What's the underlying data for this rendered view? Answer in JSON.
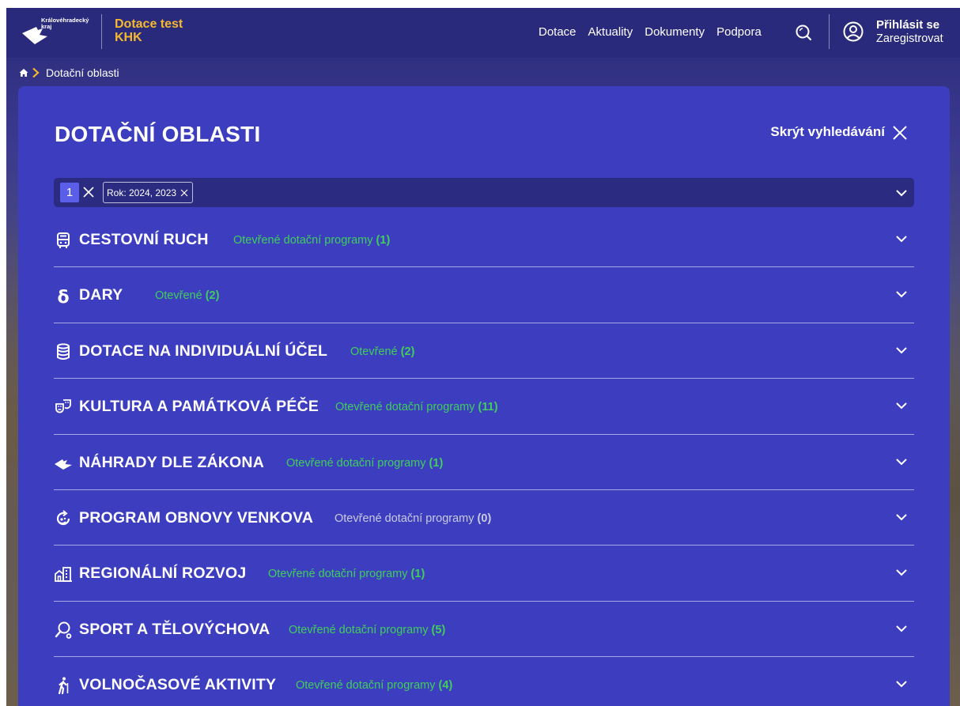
{
  "header": {
    "logo_text_line1": "Královéhradecký",
    "logo_text_line2": "kraj",
    "site_title_line1": "Dotace test",
    "site_title_line2": "KHK",
    "nav": [
      {
        "label": "Dotace"
      },
      {
        "label": "Aktuality"
      },
      {
        "label": "Dokumenty"
      },
      {
        "label": "Podpora"
      }
    ],
    "login_label": "Přihlásit se",
    "register_label": "Zaregistrovat"
  },
  "breadcrumb": {
    "current": "Dotační oblasti"
  },
  "main": {
    "title": "DOTAČNÍ OBLASTI",
    "hide_search_label": "Skrýt vyhledávání",
    "filter": {
      "count": "1",
      "chip_label": "Rok: 2024, 2023"
    },
    "categories": [
      {
        "title": "CESTOVNÍ RUCH",
        "status_label": "Otevřené dotační programy",
        "count": "(1)",
        "icon": "bus-icon",
        "status_color": "green"
      },
      {
        "title": "DARY",
        "status_label": "Otevřené",
        "count": "(2)",
        "icon": "delta-icon",
        "status_color": "green"
      },
      {
        "title": "DOTACE NA INDIVIDUÁLNÍ ÚČEL",
        "status_label": "Otevřené",
        "count": "(2)",
        "icon": "database-icon",
        "status_color": "green"
      },
      {
        "title": "KULTURA A PAMÁTKOVÁ PÉČE",
        "status_label": "Otevřené dotační programy",
        "count": "(11)",
        "icon": "theater-masks-icon",
        "status_color": "green"
      },
      {
        "title": "NÁHRADY DLE ZÁKONA",
        "status_label": "Otevřené dotační programy",
        "count": "(1)",
        "icon": "region-map-icon",
        "status_color": "green"
      },
      {
        "title": "PROGRAM OBNOVY VENKOVA",
        "status_label": "Otevřené dotační programy",
        "count": "(0)",
        "icon": "renewal-icon",
        "status_color": "gray"
      },
      {
        "title": "REGIONÁLNÍ ROZVOJ",
        "status_label": "Otevřené dotační programy",
        "count": "(1)",
        "icon": "buildings-icon",
        "status_color": "green"
      },
      {
        "title": "SPORT A TĚLOVÝCHOVA",
        "status_label": "Otevřené dotační programy",
        "count": "(5)",
        "icon": "ping-pong-icon",
        "status_color": "green"
      },
      {
        "title": "VOLNOČASOVÉ AKTIVITY",
        "status_label": "Otevřené dotační programy",
        "count": "(4)",
        "icon": "hiking-icon",
        "status_color": "green"
      }
    ]
  },
  "colors": {
    "header_bg": "#2a2a7c",
    "panel_bg": "#3d3dc0",
    "accent_yellow": "#f5b82e",
    "status_green": "#3fcf5a",
    "status_gray": "#c9cbe3"
  }
}
